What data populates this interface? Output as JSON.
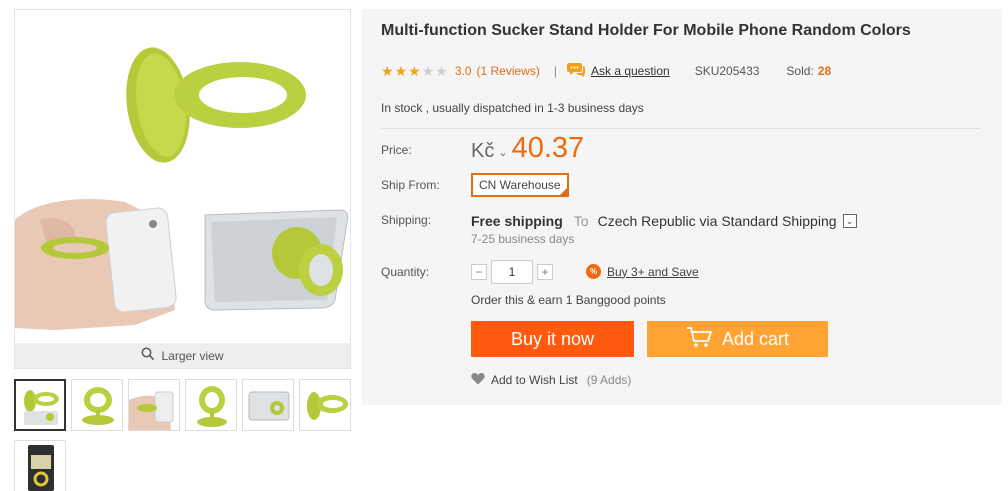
{
  "gallery": {
    "larger_view_label": "Larger view",
    "thumbnail_count": 7,
    "accent_color": "#bcd13e"
  },
  "product": {
    "title": "Multi-function Sucker Stand Holder For Mobile Phone Random Colors",
    "rating": {
      "stars_filled": 3,
      "stars_total": 5,
      "value": "3.0",
      "reviews_label": "(1 Reviews)"
    },
    "ask_label": "Ask a question",
    "sku": "SKU205433",
    "sold_label": "Sold:",
    "sold_value": "28",
    "stock_text": "In stock , usually dispatched in 1-3 business days"
  },
  "price": {
    "label": "Price:",
    "currency": "Kč",
    "currency_dropdown_icon": "chevron-down-icon",
    "value": "40.37",
    "color": "#f0690e"
  },
  "ship_from": {
    "label": "Ship From:",
    "selected": "CN Warehouse",
    "accent": "#e06e16"
  },
  "shipping": {
    "label": "Shipping:",
    "free_text": "Free shipping",
    "to_text": "To",
    "destination": "Czech Republic via Standard Shipping",
    "days": "7-25 business days"
  },
  "quantity": {
    "label": "Quantity:",
    "minus": "−",
    "plus": "+",
    "value": "1",
    "promo_badge": "%",
    "promo_link": "Buy 3+ and Save",
    "points_text": "Order this & earn 1 Banggood points"
  },
  "actions": {
    "buy_now": "Buy it now",
    "buy_color": "#ff5a0e",
    "add_cart": "Add cart",
    "cart_color": "#fea334",
    "wishlist": "Add to Wish List",
    "wishlist_count": "(9 Adds)"
  }
}
